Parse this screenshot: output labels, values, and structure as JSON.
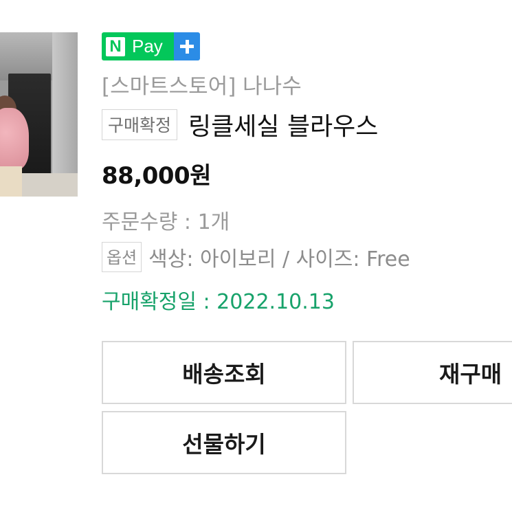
{
  "badge": {
    "n_label": "N",
    "pay_label": "Pay",
    "plus_label": "+",
    "colors": {
      "green": "#03c75a",
      "blue": "#2b8ce6"
    }
  },
  "order": {
    "store": "[스마트스토어] 나나수",
    "status_tag": "구매확정",
    "product_name": "링클세실 블라우스",
    "price": "88,000원",
    "quantity": "주문수량 : 1개",
    "option_tag": "옵션",
    "option_text": "색상: 아이보리 / 사이즈: Free",
    "confirm_date": "구매확정일 : 2022.10.13",
    "confirm_color": "#17a26a"
  },
  "actions": {
    "track_label": "배송조회",
    "rebuy_label": "재구매",
    "gift_label": "선물하기"
  }
}
